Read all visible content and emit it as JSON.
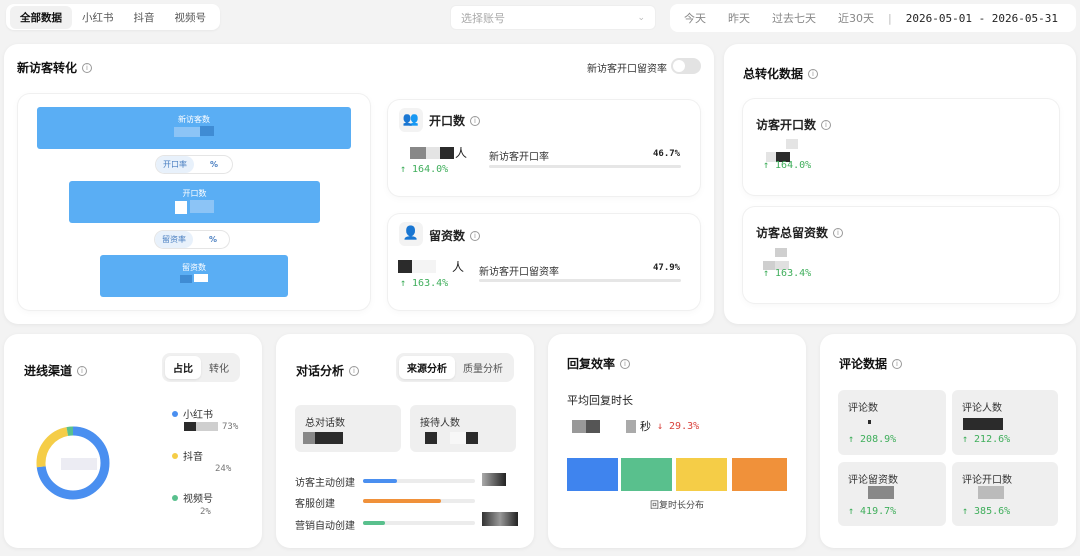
{
  "tabs": [
    "全部数据",
    "小红书",
    "抖音",
    "视频号"
  ],
  "account_select": {
    "placeholder": "选择账号"
  },
  "date_filters": {
    "options": [
      "今天",
      "昨天",
      "过去七天",
      "近30天"
    ],
    "separator": "|",
    "range": "2026-05-01 - 2026-05-31"
  },
  "new_visitor": {
    "title": "新访客转化",
    "toggle_label": "新访客开口留资率",
    "funnel": {
      "stage1": "新访客数",
      "rate1_label": "开口率",
      "rate1_unit": "%",
      "stage2": "开口数",
      "rate2_label": "留资率",
      "rate2_unit": "%",
      "stage3": "留资数"
    },
    "open": {
      "title": "开口数",
      "unit": "人",
      "growth": "↑ 164.0%",
      "rate_label": "新访客开口率",
      "rate_value": "46.7%"
    },
    "lead": {
      "title": "留资数",
      "unit": "人",
      "growth": "↑ 163.4%",
      "rate_label": "新访客开口留资率",
      "rate_value": "47.9%"
    }
  },
  "total": {
    "title": "总转化数据",
    "open": {
      "title": "访客开口数",
      "growth": "↑ 164.0%"
    },
    "lead": {
      "title": "访客总留资数",
      "growth": "↑ 163.4%"
    }
  },
  "channel": {
    "title": "进线渠道",
    "seg": [
      "占比",
      "转化"
    ],
    "items": [
      {
        "name": "小红书",
        "pct": "73%",
        "color": "#4a8ff0",
        "share": 73
      },
      {
        "name": "抖音",
        "pct": "24%",
        "color": "#f5cd47",
        "share": 24
      },
      {
        "name": "视频号",
        "pct": "2%",
        "color": "#59c08d",
        "share": 3
      }
    ]
  },
  "dialog": {
    "title": "对话分析",
    "seg": [
      "来源分析",
      "质量分析"
    ],
    "total_label": "总对话数",
    "reception_label": "接待人数",
    "bars": [
      {
        "label": "访客主动创建",
        "color": "#4a8ff0",
        "fill": 0.3
      },
      {
        "label": "客服创建",
        "color": "#f0913a",
        "fill": 0.7
      },
      {
        "label": "营销自动创建",
        "color": "#59c08d",
        "fill": 0.2
      }
    ]
  },
  "reply": {
    "title": "回复效率",
    "avg_label": "平均回复时长",
    "unit": "秒",
    "change": "↓ 29.3%",
    "dist_label": "回复时长分布",
    "dist_colors": [
      "#3f84ee",
      "#59c08d",
      "#f5cd47",
      "#f0913a"
    ]
  },
  "comment": {
    "title": "评论数据",
    "boxes": [
      {
        "label": "评论数",
        "growth": "↑ 208.9%"
      },
      {
        "label": "评论人数",
        "growth": "↑ 212.6%"
      },
      {
        "label": "评论留资数",
        "growth": "↑ 419.7%"
      },
      {
        "label": "评论开口数",
        "growth": "↑ 385.6%"
      }
    ]
  },
  "icons": {
    "info": "info-icon",
    "user": "user-icon",
    "user-check": "user-check-icon",
    "chevron": "chevron-down-icon"
  }
}
